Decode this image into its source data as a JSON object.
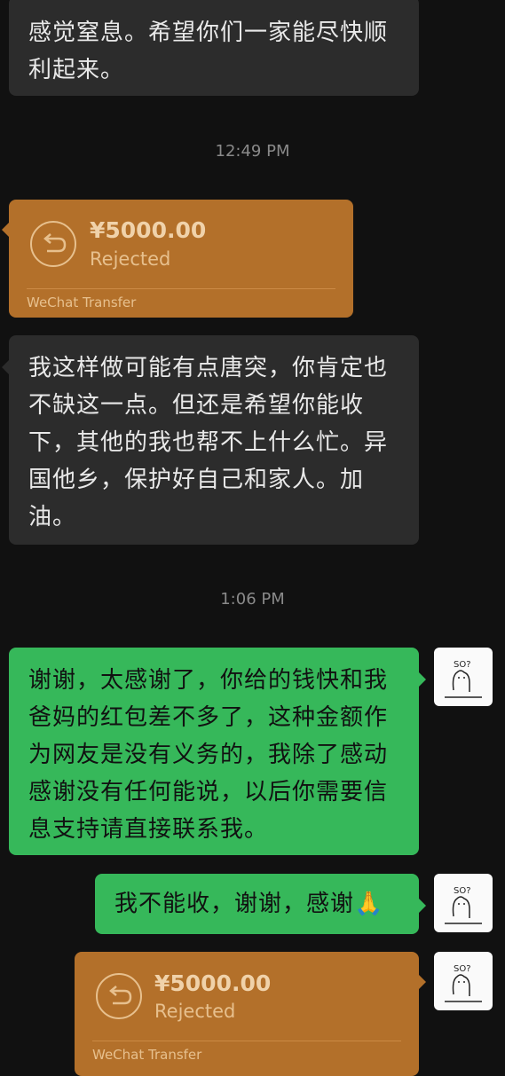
{
  "messages": [
    {
      "type": "text",
      "side": "left",
      "lines": [
        "感觉窒息。希望你们一家能尽快顺",
        "利起来。"
      ]
    },
    {
      "type": "time",
      "label": "12:49 PM"
    },
    {
      "type": "transfer",
      "side": "left",
      "amount": "¥5000.00",
      "status": "Rejected",
      "footer": "WeChat Transfer"
    },
    {
      "type": "text",
      "side": "left",
      "lines": [
        "我这样做可能有点唐突，你肯定也",
        "不缺这一点。但还是希望你能收",
        "下，其他的我也帮不上什么忙。异",
        "国他乡，保护好自己和家人。加",
        "油。"
      ]
    },
    {
      "type": "time",
      "label": "1:06 PM"
    },
    {
      "type": "text",
      "side": "right",
      "lines": [
        "谢谢，太感谢了，你给的钱快和我",
        "爸妈的红包差不多了，这种金额作",
        "为网友是没有义务的，我除了感动",
        "感谢没有任何能说，以后你需要信",
        "息支持请直接联系我。"
      ]
    },
    {
      "type": "text",
      "side": "right",
      "lines": [
        "我不能收，谢谢，感谢🙏"
      ]
    },
    {
      "type": "transfer",
      "side": "right",
      "amount": "¥5000.00",
      "status": "Rejected",
      "footer": "WeChat Transfer"
    }
  ],
  "avatar": {
    "caption": "SO?"
  },
  "colors": {
    "background": "#111111",
    "grey_bubble": "#2c2c2c",
    "green_bubble": "#36b85a",
    "transfer": "#b3702a"
  }
}
